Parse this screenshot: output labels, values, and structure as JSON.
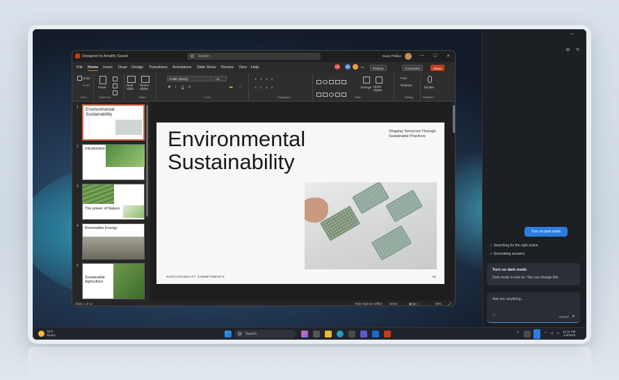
{
  "ppt": {
    "title": "Designed to Amplify  Saved",
    "search_placeholder": "Search",
    "user_name": "Daisy Phillips",
    "menu": [
      "File",
      "Home",
      "Insert",
      "Draw",
      "Design",
      "Transitions",
      "Animations",
      "Slide Show",
      "Review",
      "View",
      "Help"
    ],
    "active_menu": "Home",
    "coauthors": [
      "DM",
      "AB",
      "+4"
    ],
    "buttons": {
      "present": "Present",
      "comments": "Comments",
      "share": "Share"
    },
    "ribbon": {
      "undo": "Undo",
      "redo": "Redo",
      "paste": "Paste",
      "new_slide": "New Slide",
      "reuse_slides": "Reuse Slides",
      "font": "Calibri (Body)",
      "size": "11",
      "arrange": "Arrange",
      "quick_styles": "Quick Styles",
      "find": "Find",
      "replace": "Replace",
      "dictate": "Dictate",
      "groups": [
        "Undo",
        "Clipboard",
        "Slides",
        "Font",
        "Paragraph",
        "Style",
        "Editing",
        "Dictation"
      ]
    },
    "slides": [
      {
        "num": "1",
        "title": "Environmental Sustainability"
      },
      {
        "num": "2",
        "title": "Introduction"
      },
      {
        "num": "3",
        "title": "The power of Nature"
      },
      {
        "num": "4",
        "title": "Renewable Energy"
      },
      {
        "num": "5",
        "title": "Sustainable Agriculture"
      }
    ],
    "current_slide": {
      "title_line1": "Environmental",
      "title_line2": "Sustainability",
      "subtitle": "Shaping Tomorrow Through Sustainable Practices",
      "footer": "SUSTAINABILITY COMMITMENTS",
      "page": "01"
    },
    "status": {
      "slide_of": "Slide 1 of 12",
      "help": "Help Improve Office",
      "notes": "Notes",
      "zoom": "86%"
    }
  },
  "copilot": {
    "suggestion_button": "Turn on dark mode",
    "steps": [
      "Searching for the right action",
      "Generating answers"
    ],
    "card_title": "Turn on dark mode",
    "card_body": "Dark mode is now on. You can change this",
    "ask_placeholder": "Ask me anything...",
    "char_count": "0/4000"
  },
  "taskbar": {
    "weather_temp": "78°F",
    "weather_desc": "Sunny",
    "search": "Search",
    "time": "11:11 AM",
    "date": "1/4/2024"
  },
  "colors": {
    "accent": "#e0694b",
    "ppt_red": "#c43e1c",
    "copilot_blue": "#2b7de0"
  }
}
